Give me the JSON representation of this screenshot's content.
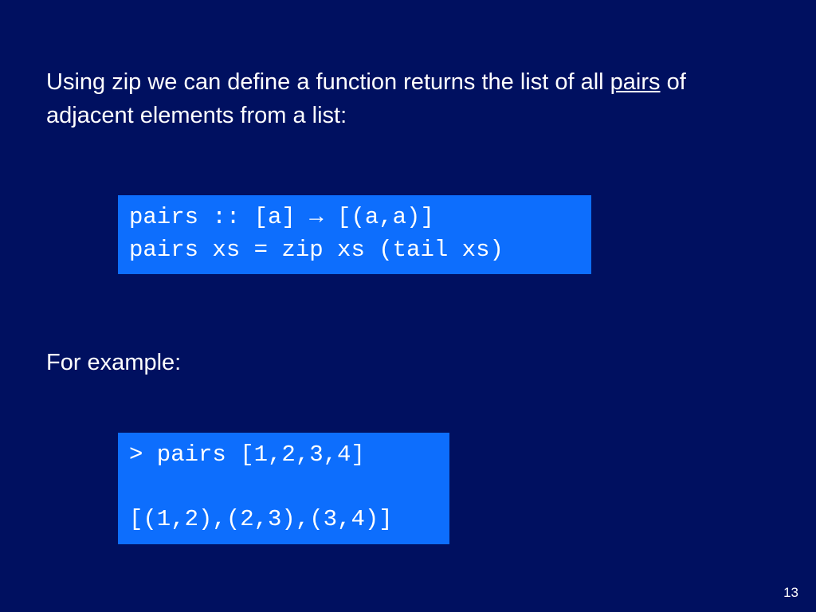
{
  "slide": {
    "para1_pre": "Using zip we can define a function returns the list of all ",
    "para1_underlined": "pairs",
    "para1_post": " of adjacent elements from a list:",
    "para2": "For example:",
    "code1": "pairs :: [a] → [(a,a)]\npairs xs = zip xs (tail xs)",
    "code2": "> pairs [1,2,3,4]\n\n[(1,2),(2,3),(3,4)]",
    "page_number": "13"
  }
}
